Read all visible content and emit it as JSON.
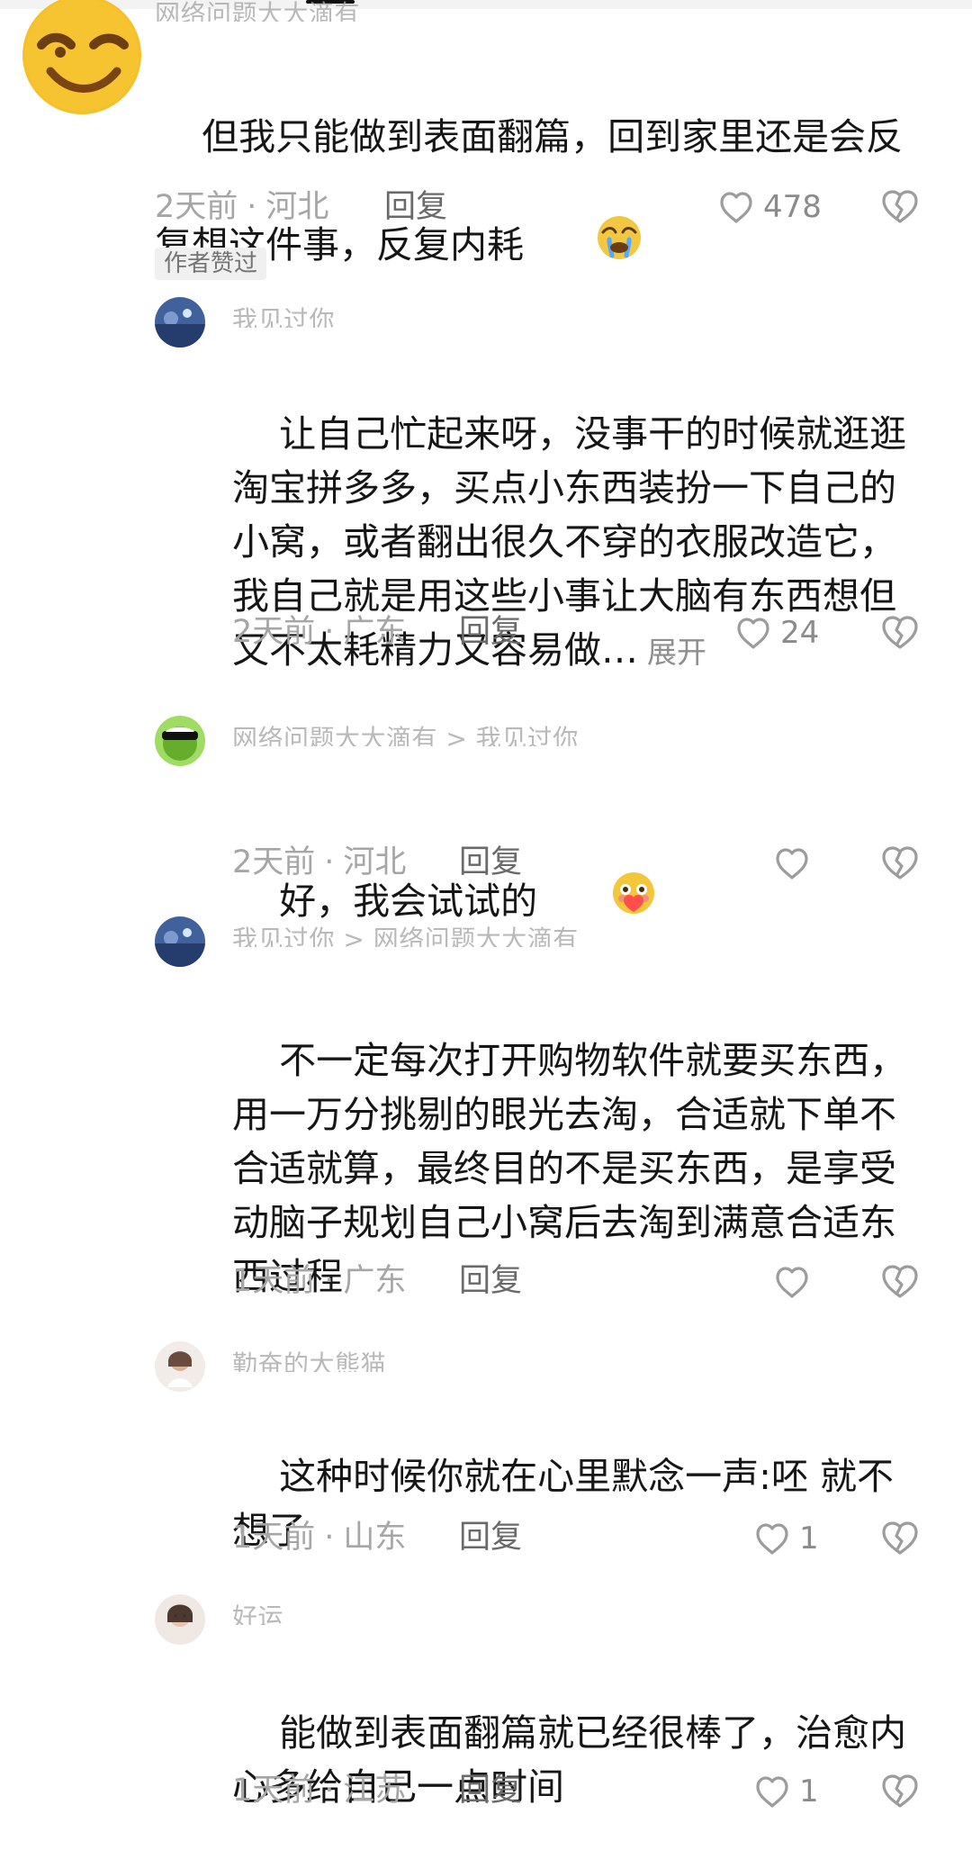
{
  "comments": [
    {
      "name": "网络问题大大滴有",
      "text": "但我只能做到表面翻篇，回到家里还是会反复想这件事，反复内耗",
      "time": "2天前",
      "location": "河北",
      "reply": "回复",
      "likes": "478",
      "badge": "作者赞过"
    },
    {
      "name": "我见过你",
      "text": "让自己忙起来呀，没事干的时候就逛逛淘宝拼多多，买点小东西装扮一下自己的小窝，或者翻出很久不穿的衣服改造它，我自己就是用这些小事让大脑有东西想但又不太耗精力又容易做…",
      "expand": "展开",
      "time": "2天前",
      "location": "广东",
      "reply": "回复",
      "likes": "24"
    },
    {
      "name": "网络问题大大滴有 > 我见过你",
      "text": "好，我会试试的",
      "time": "2天前",
      "location": "河北",
      "reply": "回复",
      "likes": ""
    },
    {
      "name": "我见过你 > 网络问题大大滴有",
      "text": "不一定每次打开购物软件就要买东西，用一万分挑剔的眼光去淘，合适就下单不合适就算，最终目的不是买东西，是享受动脑子规划自己小窝后去淘到满意合适东西过程",
      "time": "1天前",
      "location": "广东",
      "reply": "回复",
      "likes": ""
    },
    {
      "name": "勤奋的大熊猫",
      "text": "这种时候你就在心里默念一声:呸 就不想了",
      "time": "1天前",
      "location": "山东",
      "reply": "回复",
      "likes": "1"
    },
    {
      "name": "好运",
      "text": "能做到表面翻篇就已经很棒了，治愈内心多给自己一点时间",
      "time": "1天前",
      "location": "江苏",
      "reply": "回复",
      "likes": "1"
    }
  ],
  "icons": {
    "like": "heart-outline-icon",
    "dislike": "broken-heart-icon",
    "cry": "crying-face-emoji-icon",
    "shy": "blushing-heart-emoji-icon",
    "wink": "winking-face-emoji-icon"
  }
}
